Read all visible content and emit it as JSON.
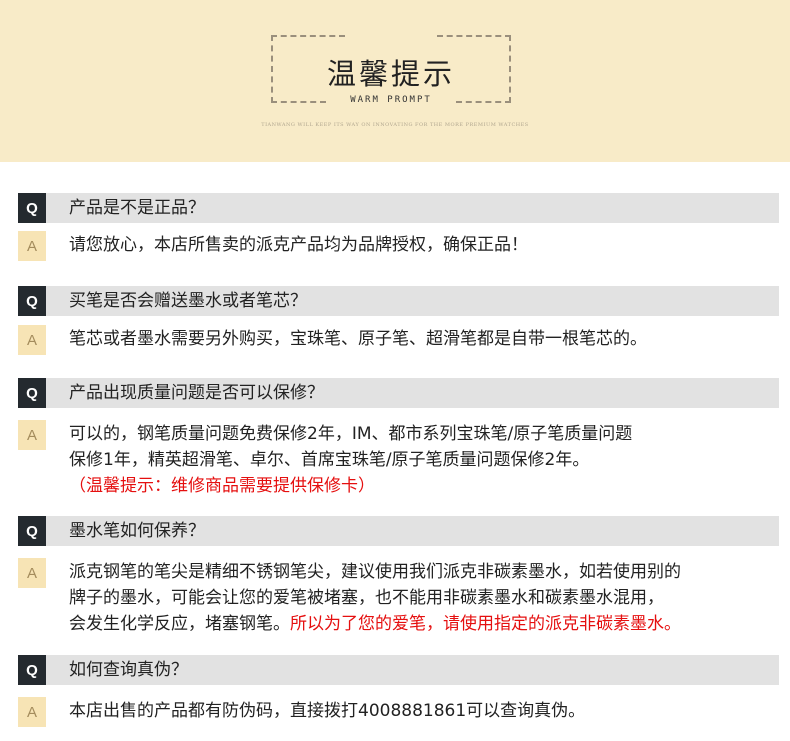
{
  "header": {
    "title": "温馨提示",
    "subtitle": "WARM PROMPT",
    "fine_print": "TIANWANG WILL KEEP ITS WAY ON INNOVATING FOR THE MORE PREMIUM WATCHES"
  },
  "badges": {
    "q": "Q",
    "a": "A"
  },
  "faq": [
    {
      "question": "产品是不是正品？",
      "answer": [
        "请您放心，本店所售卖的派克产品均为品牌授权，确保正品！"
      ]
    },
    {
      "question": "买笔是否会赠送墨水或者笔芯？",
      "answer": [
        "笔芯或者墨水需要另外购买，宝珠笔、原子笔、超滑笔都是自带一根笔芯的。"
      ]
    },
    {
      "question": "产品出现质量问题是否可以保修？",
      "answer": [
        "可以的，钢笔质量问题免费保修2年，IM、都市系列宝珠笔/原子笔质量问题",
        "保修1年，精英超滑笔、卓尔、首席宝珠笔/原子笔质量问题保修2年。"
      ],
      "note": "（温馨提示：维修商品需要提供保修卡）"
    },
    {
      "question": "墨水笔如何保养？",
      "answer": [
        "派克钢笔的笔尖是精细不锈钢笔尖，建议使用我们派克非碳素墨水，如若使用别的",
        "牌子的墨水，可能会让您的爱笔被堵塞，也不能用非碳素墨水和碳素墨水混用，",
        "会发生化学反应，堵塞钢笔。"
      ],
      "answer_highlight": "所以为了您的爱笔，请使用指定的派克非碳素墨水。"
    },
    {
      "question": "如何查询真伪？",
      "answer": [
        "本店出售的产品都有防伪码，直接拨打4008881861可以查询真伪。"
      ]
    }
  ],
  "colors": {
    "header_bg": "#f8ebc8",
    "q_badge_bg": "#242a2f",
    "a_badge_bg": "#f7e4b5",
    "question_bar_bg": "#e2e2e2",
    "highlight": "#e50f0f"
  }
}
